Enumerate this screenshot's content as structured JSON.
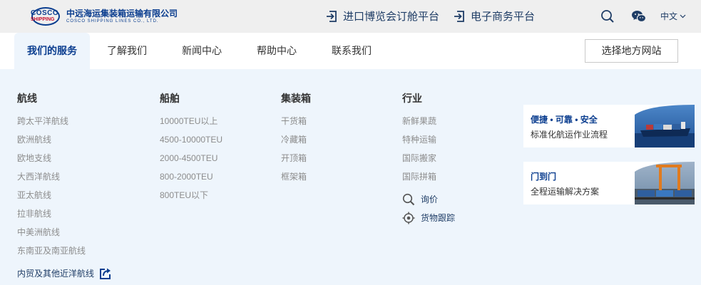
{
  "header": {
    "logo": {
      "mark_top": "COSCO",
      "mark_bottom": "SHIPPING",
      "name_cn": "中远海运集装箱运输有限公司",
      "name_en": "COSCO SHIPPING LINES CO., LTD."
    },
    "links": [
      {
        "label": "进口博览会订舱平台",
        "icon": "login-arrow-icon"
      },
      {
        "label": "电子商务平台",
        "icon": "login-arrow-icon"
      }
    ],
    "language": "中文"
  },
  "nav": {
    "items": [
      {
        "label": "我们的服务",
        "active": true
      },
      {
        "label": "了解我们"
      },
      {
        "label": "新闻中心"
      },
      {
        "label": "帮助中心"
      },
      {
        "label": "联系我们"
      }
    ],
    "region_button": "选择地方网站"
  },
  "menu": {
    "routes": {
      "title": "航线",
      "items": [
        "跨太平洋航线",
        "欧洲航线",
        "欧地支线",
        "大西洋航线",
        "亚太航线",
        "拉非航线",
        "中美洲航线",
        "东南亚及南亚航线"
      ],
      "link": "内贸及其他近洋航线"
    },
    "vessels": {
      "title": "船舶",
      "items": [
        "10000TEU以上",
        "4500-10000TEU",
        "2000-4500TEU",
        "800-2000TEU",
        "800TEU以下"
      ]
    },
    "containers": {
      "title": "集装箱",
      "items": [
        "干货箱",
        "冷藏箱",
        "开顶箱",
        "框架箱"
      ]
    },
    "industry": {
      "title": "行业",
      "items": [
        "新鲜果蔬",
        "特种运输",
        "国际搬家",
        "国际拼箱"
      ],
      "actions": [
        {
          "label": "询价",
          "icon": "magnifier-icon"
        },
        {
          "label": "货物跟踪",
          "icon": "target-icon"
        }
      ]
    }
  },
  "cards": [
    {
      "title": "便捷 • 可靠 • 安全",
      "subtitle": "标准化航运作业流程"
    },
    {
      "title": "门到门",
      "subtitle": "全程运输解决方案"
    }
  ],
  "colors": {
    "brand": "#0a3d8f",
    "accent_red": "#c8102e",
    "link": "#1f3d66",
    "muted": "#8c8c8c",
    "menu_bg": "#eef5fc"
  }
}
